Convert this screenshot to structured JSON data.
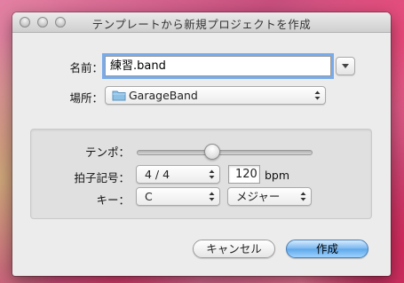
{
  "window": {
    "title": "テンプレートから新規プロジェクトを作成"
  },
  "form": {
    "name_label": "名前：",
    "name_value": "練習.band",
    "location_label": "場所：",
    "location_value": "GarageBand"
  },
  "settings": {
    "tempo_label": "テンポ：",
    "tempo_slider_position": 0.42,
    "time_signature_label": "拍子記号：",
    "time_signature_value": "4 / 4",
    "bpm_value": "120",
    "bpm_unit": "bpm",
    "key_label": "キー：",
    "key_value": "C",
    "mode_value": "メジャー"
  },
  "buttons": {
    "cancel_label": "キャンセル",
    "create_label": "作成"
  },
  "icons": {
    "close": "close-icon",
    "minimize": "minimize-icon",
    "zoom": "zoom-icon",
    "disclosure": "disclosure-triangle-icon",
    "folder": "folder-icon",
    "popup_arrows": "popup-arrows-icon"
  },
  "colors": {
    "default_button": "#6cb0ee",
    "focus_ring": "#64a0eb",
    "folder": "#8ec1e6"
  }
}
